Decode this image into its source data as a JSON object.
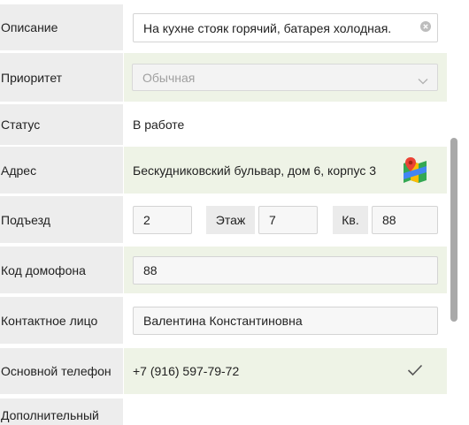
{
  "form": {
    "description": {
      "label": "Описание",
      "value": "На кухне стояк горячий, батарея холодная."
    },
    "priority": {
      "label": "Приоритет",
      "placeholder": "Обычная"
    },
    "status": {
      "label": "Статус",
      "value": "В работе"
    },
    "address": {
      "label": "Адрес",
      "value": "Бескудниковский бульвар, дом 6, корпус 3",
      "map_icon": "map-icon"
    },
    "entrance": {
      "label": "Подъезд",
      "value": "2",
      "floor_label": "Этаж",
      "floor_value": "7",
      "apt_label": "Кв.",
      "apt_value": "88"
    },
    "intercom": {
      "label": "Код домофона",
      "value": "88"
    },
    "contact": {
      "label": "Контактное лицо",
      "value": "Валентина Константиновна"
    },
    "main_phone": {
      "label": "Основной телефон",
      "value": "+7 (916) 597-79-72",
      "verified_icon": "checkmark-icon"
    },
    "extra_phone": {
      "label": "Дополнительный"
    }
  },
  "colors": {
    "label_bg": "#ededed",
    "highlight_bg": "#eef3e6",
    "input_bg": "#f7f7f7"
  }
}
